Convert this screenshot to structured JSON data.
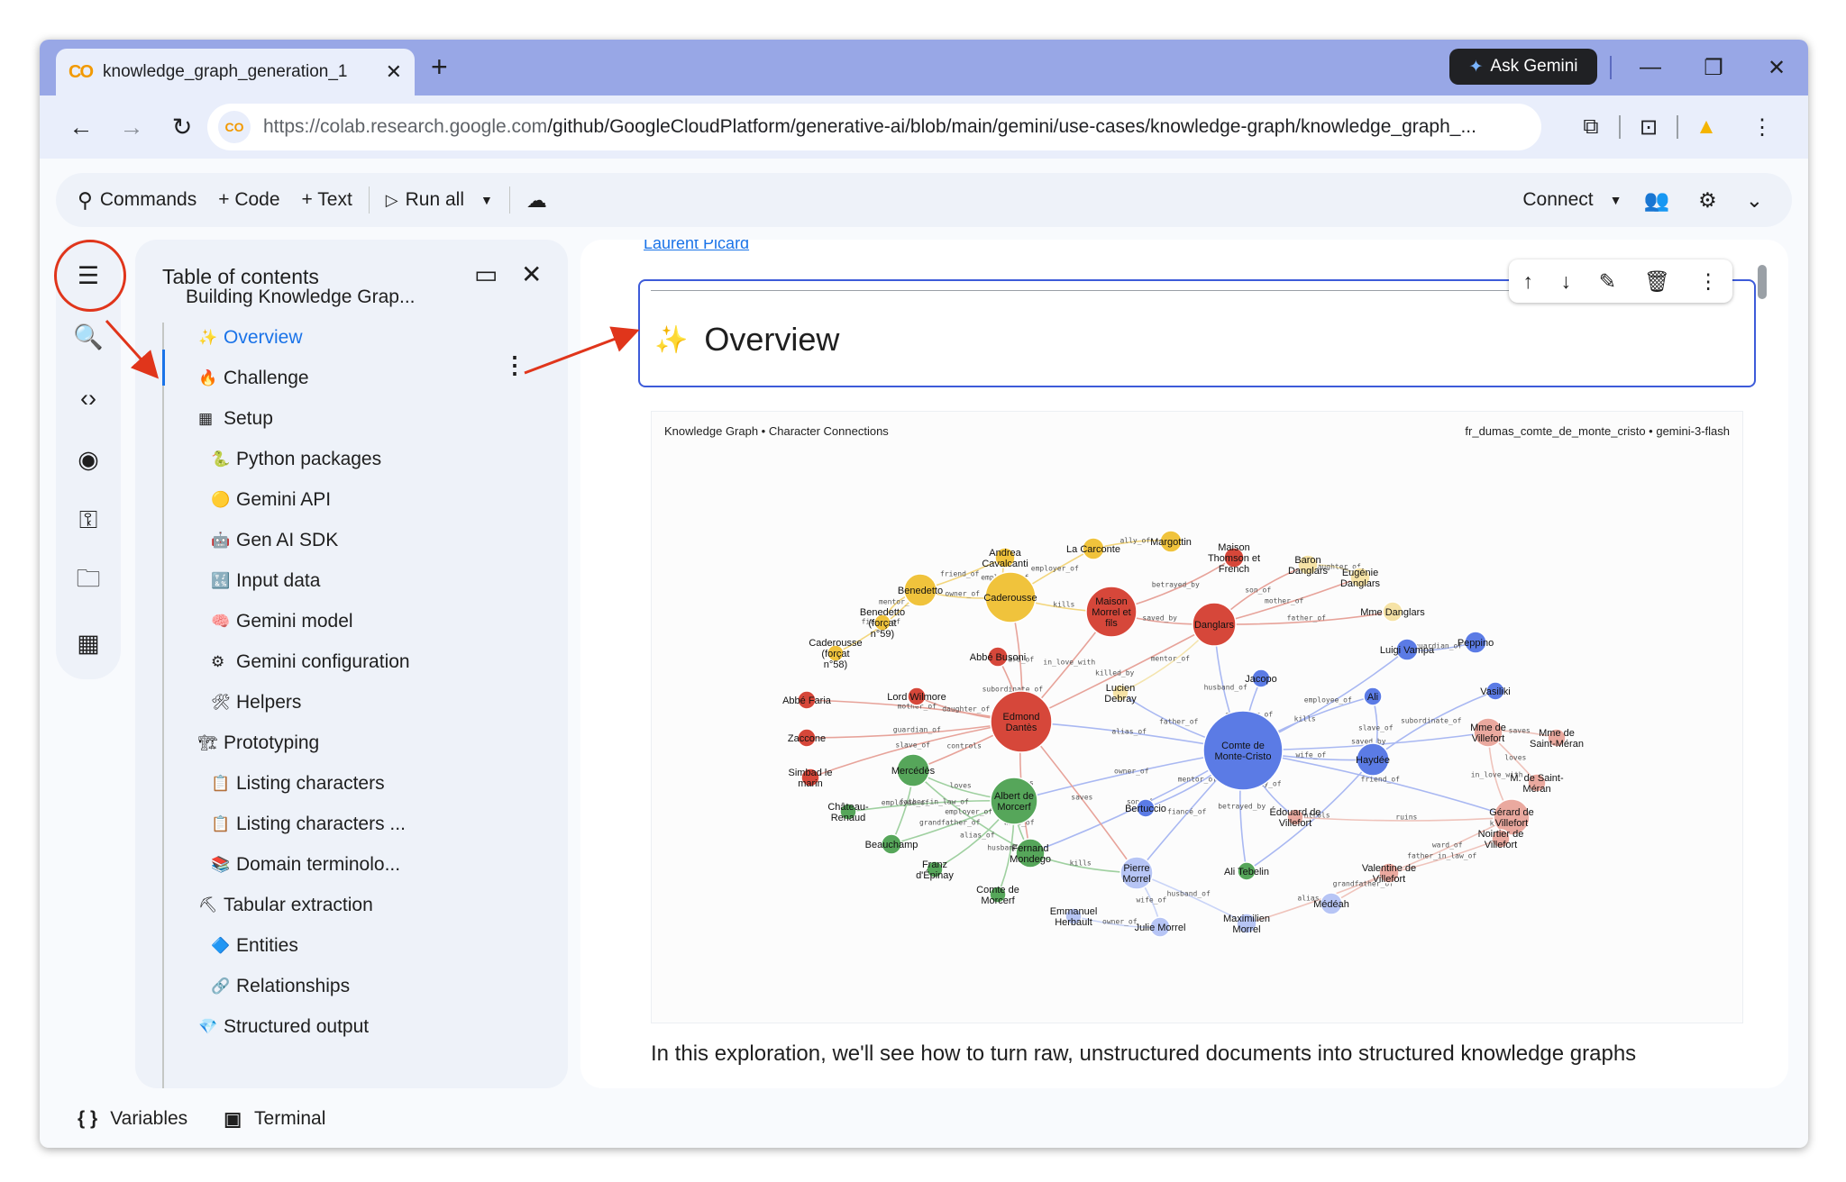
{
  "browser": {
    "tab_title": "knowledge_graph_generation_1",
    "url_domain": "https://colab.research.google.com",
    "url_path": "/github/GoogleCloudPlatform/generative-ai/blob/main/gemini/use-cases/knowledge-graph/knowledge_graph_...",
    "ask_gemini": "Ask Gemini"
  },
  "toolbar": {
    "commands": "Commands",
    "code": "+ Code",
    "text": "+ Text",
    "run_all": "Run all",
    "connect": "Connect"
  },
  "toc": {
    "title": "Table of contents",
    "items": [
      {
        "label": "Building Knowledge Grap...",
        "emoji": "",
        "level": 0
      },
      {
        "label": "Overview",
        "emoji": "✨",
        "level": 1
      },
      {
        "label": "Challenge",
        "emoji": "🔥",
        "level": 1
      },
      {
        "label": "Setup",
        "emoji": "▦",
        "level": 1
      },
      {
        "label": "Python packages",
        "emoji": "🐍",
        "level": 2
      },
      {
        "label": "Gemini API",
        "emoji": "🟡",
        "level": 2
      },
      {
        "label": "Gen AI SDK",
        "emoji": "🤖",
        "level": 2
      },
      {
        "label": "Input data",
        "emoji": "🔣",
        "level": 2
      },
      {
        "label": "Gemini model",
        "emoji": "🧠",
        "level": 2
      },
      {
        "label": "Gemini configuration",
        "emoji": "⚙",
        "level": 2
      },
      {
        "label": "Helpers",
        "emoji": "🛠",
        "level": 2
      },
      {
        "label": "Prototyping",
        "emoji": "🏗",
        "level": 1
      },
      {
        "label": "Listing characters",
        "emoji": "📋",
        "level": 2
      },
      {
        "label": "Listing characters ...",
        "emoji": "📋",
        "level": 2
      },
      {
        "label": "Domain terminolo...",
        "emoji": "📚",
        "level": 2
      },
      {
        "label": "Tabular extraction",
        "emoji": "⛏",
        "level": 1
      },
      {
        "label": "Entities",
        "emoji": "🔷",
        "level": 2
      },
      {
        "label": "Relationships",
        "emoji": "🔗",
        "level": 2
      },
      {
        "label": "Structured output",
        "emoji": "💎",
        "level": 1
      }
    ]
  },
  "notebook": {
    "prev_link": "Laurent Picard",
    "cell_title": "Overview",
    "intro_text": "In this exploration, we'll see how to turn raw, unstructured documents into structured knowledge graphs"
  },
  "graph": {
    "header_left": "Knowledge Graph • Character Connections",
    "header_right": "fr_dumas_comte_de_monte_cristo • gemini-3-flash",
    "colors": {
      "red": "#d6473a",
      "yellow": "#f0c33c",
      "green": "#56a65a",
      "blue": "#5b7be5",
      "pink": "#eaa99f",
      "lightblue": "#b7c5f5",
      "lightyellow": "#f6e3a6"
    },
    "nodes": [
      {
        "label": "Comte de Monte-Cristo",
        "color": "blue"
      },
      {
        "label": "Edmond Dantès",
        "color": "red"
      },
      {
        "label": "Albert de Morcerf",
        "color": "green"
      },
      {
        "label": "Danglars",
        "color": "red"
      },
      {
        "label": "Caderousse",
        "color": "yellow"
      },
      {
        "label": "Maison Morrel et fils",
        "color": "red"
      },
      {
        "label": "Mercédès",
        "color": "green"
      },
      {
        "label": "Haydée",
        "color": "blue"
      },
      {
        "label": "Gérard de Villefort",
        "color": "pink"
      },
      {
        "label": "Mme de Villefort",
        "color": "pink"
      },
      {
        "label": "Fernand Mondego",
        "color": "green"
      },
      {
        "label": "Pierre Morrel",
        "color": "lightblue"
      },
      {
        "label": "Benedetto",
        "color": "yellow"
      },
      {
        "label": "Andrea Cavalcanti",
        "color": "yellow"
      },
      {
        "label": "La Carconte",
        "color": "yellow"
      },
      {
        "label": "Margottin",
        "color": "yellow"
      },
      {
        "label": "Maison Thomson et French",
        "color": "red"
      },
      {
        "label": "Baron Danglars",
        "color": "lightyellow"
      },
      {
        "label": "Eugénie Danglars",
        "color": "lightyellow"
      },
      {
        "label": "Mme Danglars",
        "color": "lightyellow"
      },
      {
        "label": "Benedetto (forçat n°59)",
        "color": "yellow"
      },
      {
        "label": "Caderousse (forçat n°58)",
        "color": "yellow"
      },
      {
        "label": "Abbé Busoni",
        "color": "red"
      },
      {
        "label": "Abbé Faria",
        "color": "red"
      },
      {
        "label": "Lord Wilmore",
        "color": "red"
      },
      {
        "label": "Zaccone",
        "color": "red"
      },
      {
        "label": "Simbad le marin",
        "color": "red"
      },
      {
        "label": "Lucien Debray",
        "color": "lightyellow"
      },
      {
        "label": "Jacopo",
        "color": "blue"
      },
      {
        "label": "Luigi Vampa",
        "color": "blue"
      },
      {
        "label": "Peppino",
        "color": "blue"
      },
      {
        "label": "Ali",
        "color": "blue"
      },
      {
        "label": "Vasiliki",
        "color": "blue"
      },
      {
        "label": "Bertuccio",
        "color": "blue"
      },
      {
        "label": "Château-Renaud",
        "color": "green"
      },
      {
        "label": "Beauchamp",
        "color": "green"
      },
      {
        "label": "Franz d'Épinay",
        "color": "green"
      },
      {
        "label": "Comte de Morcerf",
        "color": "green"
      },
      {
        "label": "Édouard de Villefort",
        "color": "pink"
      },
      {
        "label": "Mme de Saint-Méran",
        "color": "pink"
      },
      {
        "label": "M. de Saint-Méran",
        "color": "pink"
      },
      {
        "label": "Noirtier de Villefort",
        "color": "pink"
      },
      {
        "label": "Valentine de Villefort",
        "color": "pink"
      },
      {
        "label": "Ali Tebelin",
        "color": "green"
      },
      {
        "label": "Médéah",
        "color": "lightblue"
      },
      {
        "label": "Maximilien Morrel",
        "color": "lightblue"
      },
      {
        "label": "Julie Morrel",
        "color": "lightblue"
      },
      {
        "label": "Emmanuel Herbault",
        "color": "lightblue"
      }
    ],
    "edge_labels": [
      "alias_of",
      "wife_of",
      "husband_of",
      "owner_of",
      "employer_of",
      "employee_of",
      "kills",
      "mentor_of",
      "fiancé_of",
      "friend_of",
      "ally_of",
      "saved_by",
      "betrayed_by",
      "son_of",
      "father_of",
      "mother_of",
      "daughter_of",
      "guardian_of",
      "slave_of",
      "subordinate_of",
      "controls",
      "in_love_with",
      "killed_by",
      "ward_of",
      "ruins",
      "saves",
      "loves",
      "father_in_law_of",
      "grandfather_of"
    ]
  },
  "statusbar": {
    "variables": "Variables",
    "terminal": "Terminal"
  }
}
